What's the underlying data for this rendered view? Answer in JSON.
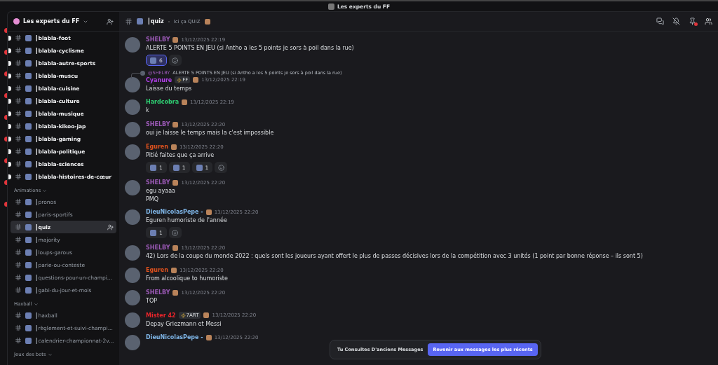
{
  "window": {
    "title": "Les experts du FF"
  },
  "server": {
    "name": "Les experts du FF"
  },
  "sidebar": {
    "sections": [
      {
        "channels": [
          {
            "name": "┃blabla-foot",
            "unread": true,
            "selected": false
          },
          {
            "name": "┃blabla-cyclisme",
            "unread": true,
            "selected": false
          },
          {
            "name": "┃blabla-autre-sports",
            "unread": true,
            "selected": false
          },
          {
            "name": "┃blabla-muscu",
            "unread": true,
            "selected": false
          },
          {
            "name": "┃blabla-cuisine",
            "unread": true,
            "selected": false
          },
          {
            "name": "┃blabla-culture",
            "unread": true,
            "selected": false
          },
          {
            "name": "┃blabla-musique",
            "unread": true,
            "selected": false
          },
          {
            "name": "┃blabla-kikoo-jap",
            "unread": true,
            "selected": false
          },
          {
            "name": "┃blabla-gaming",
            "unread": true,
            "selected": false
          },
          {
            "name": "┃blabla-politique",
            "unread": true,
            "selected": false
          },
          {
            "name": "┃blabla-sciences",
            "unread": true,
            "selected": false
          },
          {
            "name": "┃blabla-histoires-de-cœur",
            "unread": true,
            "selected": false
          }
        ]
      },
      {
        "title": "Animations",
        "channels": [
          {
            "name": "┃pronos",
            "unread": false,
            "selected": false
          },
          {
            "name": "┃paris-sportifs",
            "unread": false,
            "selected": false
          },
          {
            "name": "┃quiz",
            "unread": false,
            "selected": true
          },
          {
            "name": "┃majority",
            "unread": false,
            "selected": false
          },
          {
            "name": "┃loups-garous",
            "unread": false,
            "selected": false
          },
          {
            "name": "┃parie-ou-conteste",
            "unread": false,
            "selected": false
          },
          {
            "name": "┃questions-pour-un-champi...",
            "unread": false,
            "selected": false
          },
          {
            "name": "┃gabi-du-jour-et-mois",
            "unread": false,
            "selected": false
          }
        ]
      },
      {
        "title": "Haxball",
        "channels": [
          {
            "name": "┃haxball",
            "unread": false,
            "selected": false
          },
          {
            "name": "┃règlement-et-suivi-champi...",
            "unread": false,
            "selected": false
          },
          {
            "name": "┃calendrier-championnat-2v...",
            "unread": false,
            "selected": false
          }
        ]
      },
      {
        "title": "Jeux des bots"
      }
    ]
  },
  "header": {
    "channel": "┃quiz",
    "topic": "Ici ça QUIZ"
  },
  "messages": [
    {
      "author": "SHELBY",
      "color": "#9b59b6",
      "time": "13/12/2025 22:19",
      "lines": [
        "ALERTE 5 POINTS EN JEU (si Antho a les 5 points je sors à poil dans la rue)"
      ],
      "reactions": [
        {
          "count": "6",
          "selected": true
        }
      ]
    },
    {
      "author": "Cyanure",
      "color": "#b040e8",
      "tag": "FF",
      "time": "13/12/2025 22:19",
      "reply": {
        "author": "@SHELBY",
        "text": "ALERTE 5 POINTS EN JEU (si Antho a les 5 points je sors à poil dans la rue)"
      },
      "lines": [
        "Laisse du temps"
      ]
    },
    {
      "author": "Hardcobra",
      "color": "#2ecc71",
      "time": "13/12/2025 22:19",
      "lines": [
        "k"
      ]
    },
    {
      "author": "SHELBY",
      "color": "#9b59b6",
      "time": "13/12/2025 22:20",
      "lines": [
        "oui je laisse le temps mais la c'est impossible"
      ]
    },
    {
      "author": "Eguren",
      "color": "#e0521e",
      "time": "13/12/2025 22:20",
      "lines": [
        "Pitié faites que ça arrive"
      ],
      "reactions": [
        {
          "count": "1",
          "selected": false
        },
        {
          "count": "1",
          "selected": false
        },
        {
          "count": "1",
          "selected": false
        }
      ]
    },
    {
      "author": "SHELBY",
      "color": "#9b59b6",
      "time": "13/12/2025 22:20",
      "lines": [
        "egu ayaaa",
        "PMQ"
      ]
    },
    {
      "author": "DieuNicolasPepe -",
      "color": "#7fb6e8",
      "time": "13/12/2025 22:20",
      "lines": [
        "Eguren humoriste de l'année"
      ],
      "reactions": [
        {
          "count": "1",
          "selected": false
        }
      ]
    },
    {
      "author": "SHELBY",
      "color": "#9b59b6",
      "time": "13/12/2025 22:20",
      "lines": [
        "42)  Lors de la coupe du monde 2022 : quels sont les joueurs ayant offert le plus de passes décisives lors de la compétition avec 3 unités (1 point par bonne réponse – ils sont 5)"
      ]
    },
    {
      "author": "Eguren",
      "color": "#e0521e",
      "time": "13/12/2025 22:20",
      "lines": [
        "From alcoolique to humoriste"
      ]
    },
    {
      "author": "SHELBY",
      "color": "#9b59b6",
      "time": "13/12/2025 22:20",
      "lines": [
        "TOP"
      ]
    },
    {
      "author": "Mister 42",
      "color": "#e8252b",
      "tag": "7ART",
      "time": "13/12/2025 22:20",
      "lines": [
        "Depay Griezmann et Messi"
      ]
    },
    {
      "author": "DieuNicolasPepe -",
      "color": "#7fb6e8",
      "time": "13/12/2025 22:20"
    }
  ],
  "banner": {
    "text": "Tu Consultes D'anciens Messages",
    "button": "Revenir aux messages les plus récents"
  }
}
